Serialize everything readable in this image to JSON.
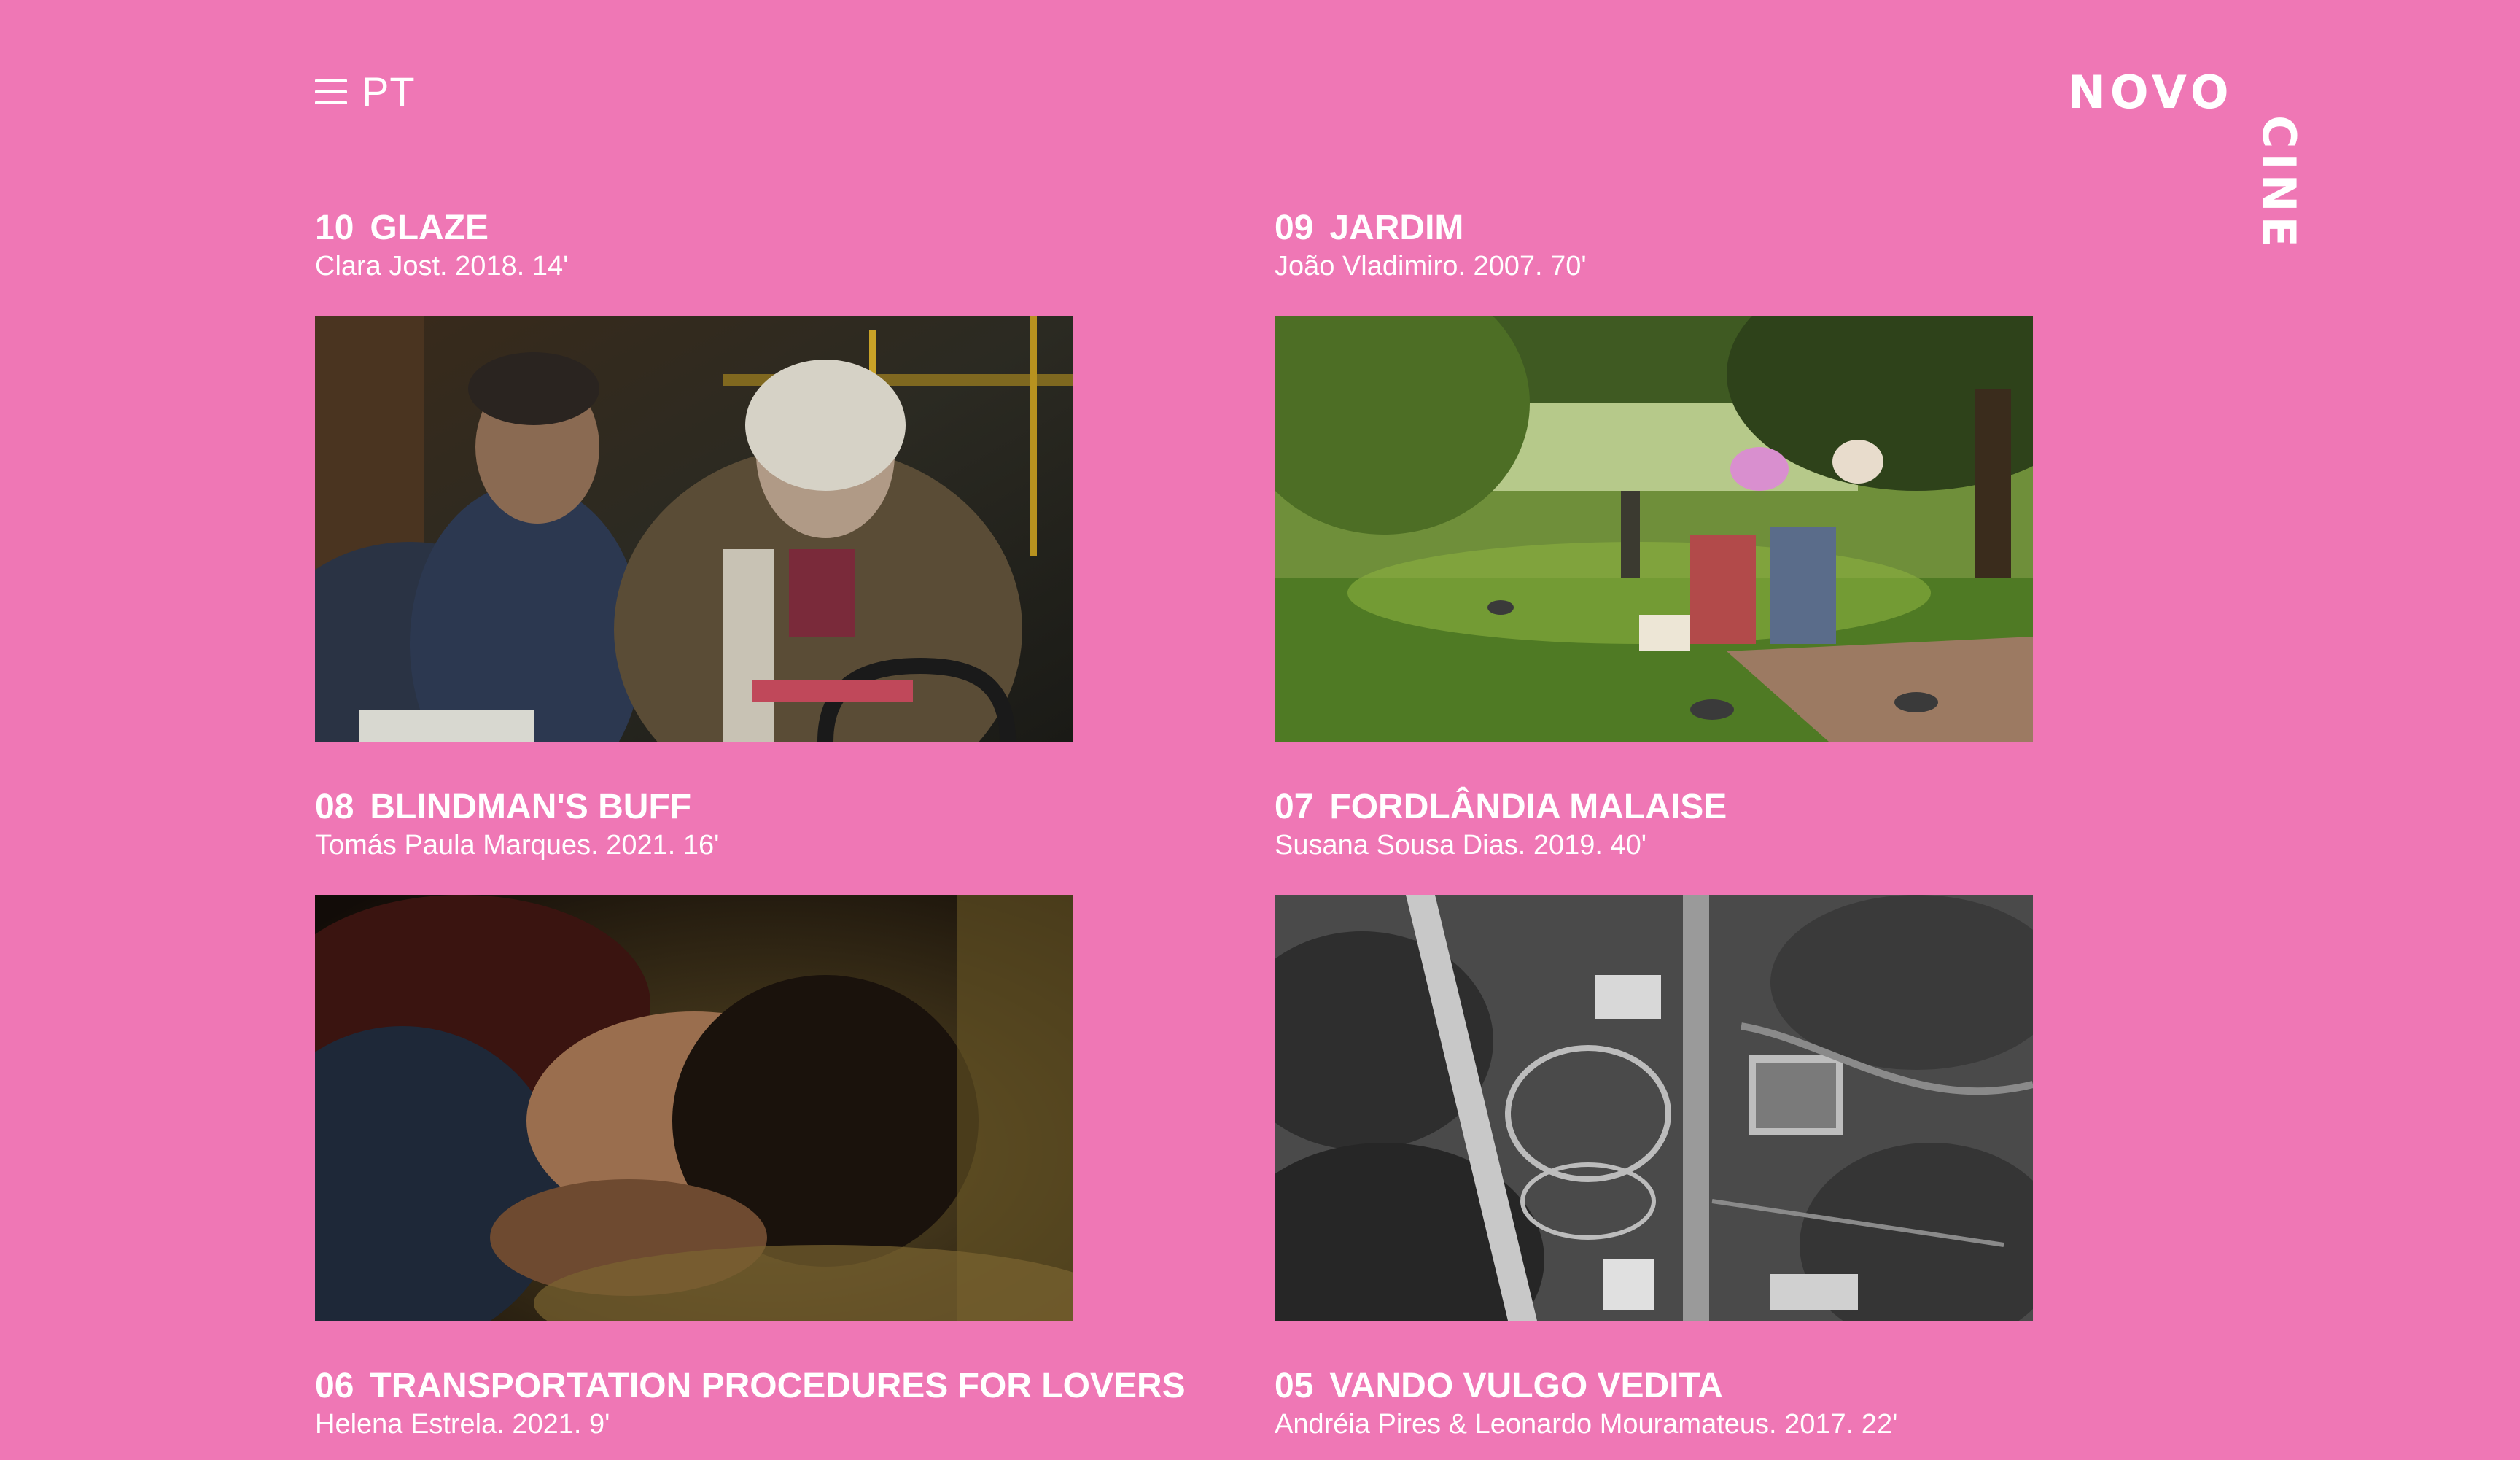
{
  "header": {
    "menu_icon": "hamburger-menu-icon",
    "language": "PT",
    "logo": {
      "line1": "NOVO",
      "line2": "CINE"
    }
  },
  "colors": {
    "background": "#ef77b5",
    "text": "#ffffff"
  },
  "films": [
    {
      "number": "10",
      "title": "GLAZE",
      "credits": "Clara Jost. 2018. 14'"
    },
    {
      "number": "09",
      "title": "JARDIM",
      "credits": "João Vladimiro. 2007. 70'"
    },
    {
      "number": "08",
      "title": "BLINDMAN'S BUFF",
      "credits": "Tomás Paula Marques. 2021. 16'"
    },
    {
      "number": "07",
      "title": "FORDLÂNDIA MALAISE",
      "credits": "Susana Sousa Dias. 2019. 40'"
    },
    {
      "number": "06",
      "title": "TRANSPORTATION PROCEDURES FOR LOVERS",
      "credits": "Helena Estrela. 2021. 9'"
    },
    {
      "number": "05",
      "title": "VANDO VULGO VEDITA",
      "credits": "Andréia Pires & Leonardo Mouramateus. 2017. 22'"
    }
  ]
}
